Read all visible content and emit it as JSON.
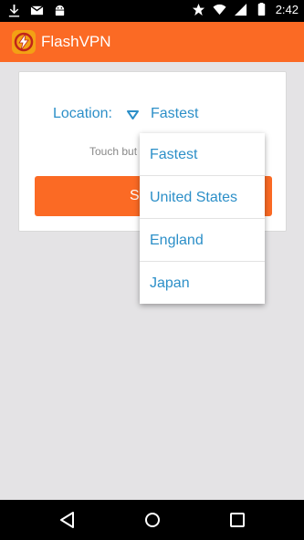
{
  "status_bar": {
    "time": "2:42",
    "icons": [
      "download-icon",
      "mail-icon",
      "android-icon",
      "star-icon",
      "wifi-icon",
      "signal-icon",
      "battery-icon"
    ]
  },
  "app_bar": {
    "title": "FlashVPN",
    "logo_icon": "flash-logo-icon",
    "color": "#fb6a24"
  },
  "card": {
    "location_label": "Location:",
    "location_value": "Fastest",
    "hint": "Touch but",
    "start_button_label": "S"
  },
  "dropdown": {
    "options": [
      "Fastest",
      "United States",
      "England",
      "Japan"
    ]
  },
  "nav_bar": {
    "icons": [
      "back-icon",
      "home-icon",
      "recents-icon"
    ]
  },
  "colors": {
    "accent": "#fb6a24",
    "link_blue": "#2c8fc8",
    "background": "#e4e3e5"
  }
}
